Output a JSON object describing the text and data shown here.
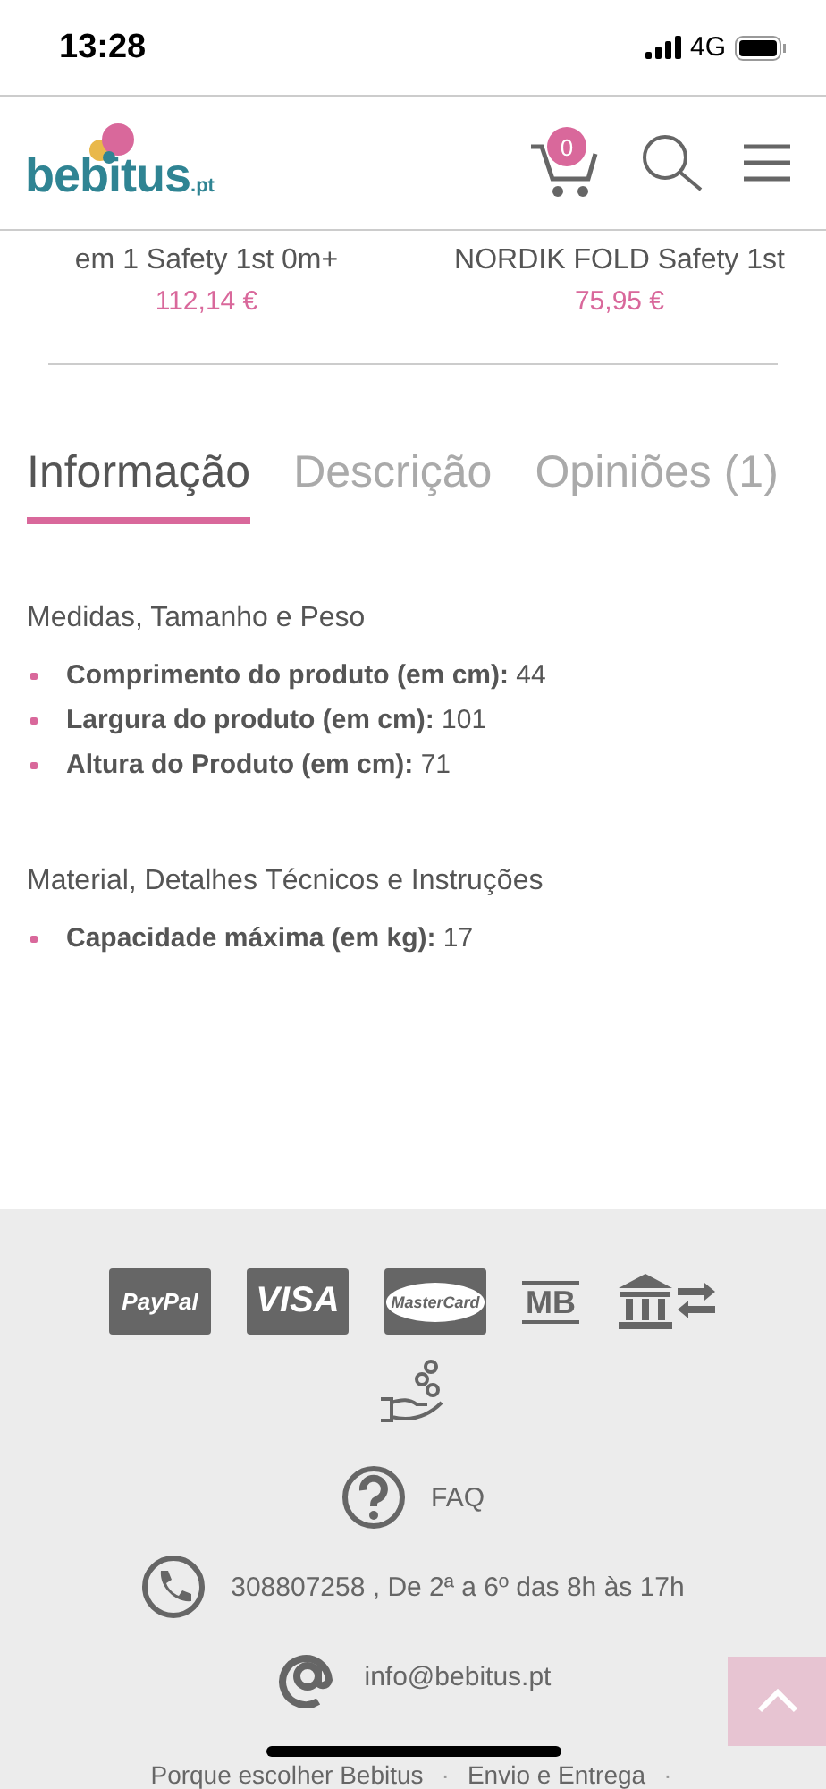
{
  "status_bar": {
    "time": "13:28",
    "network": "4G"
  },
  "header": {
    "logo": {
      "name": "bebitus",
      "suffix": ".pt"
    },
    "cart_count": "0"
  },
  "products": [
    {
      "name": "em 1 Safety 1st 0m+",
      "price": "112,14 €"
    },
    {
      "name": "NORDIK FOLD Safety 1st",
      "price": "75,95 €"
    }
  ],
  "tabs": [
    {
      "label": "Informação",
      "selected": true
    },
    {
      "label": "Descrição",
      "selected": false
    },
    {
      "label": "Opiniões (1)",
      "selected": false
    }
  ],
  "sections": [
    {
      "title": "Medidas, Tamanho e Peso",
      "items": [
        "**Comprimento do produto (em cm):** 44",
        "**Largura do produto (em cm):** 101",
        "**Altura do Produto (em cm):** 71"
      ]
    },
    {
      "title": "Material, Detalhes Técnicos e Instruções",
      "items": [
        "**Capacidade máxima (em kg):** 17"
      ]
    }
  ],
  "footer": {
    "payment_methods": [
      {
        "kind": "paypal",
        "label": "PayPal"
      },
      {
        "kind": "visa",
        "label": "VISA"
      },
      {
        "kind": "mastercard",
        "label": "MasterCard"
      },
      {
        "kind": "multibanco",
        "label": "MB"
      },
      {
        "kind": "transfer"
      },
      {
        "kind": "cash"
      }
    ],
    "contacts": [
      {
        "kind": "faq",
        "text": "FAQ"
      },
      {
        "kind": "phone",
        "text": "308807258 ,  De 2ª a 6º das 8h às 17h"
      },
      {
        "kind": "email",
        "text": "info@bebitus.pt"
      }
    ],
    "links": [
      {
        "kind": "link",
        "text": "Porque escolher Bebitus"
      },
      {
        "kind": "separator",
        "text": "·"
      },
      {
        "kind": "link",
        "text": "Envio e Entrega"
      },
      {
        "kind": "separator",
        "text": "·"
      }
    ]
  }
}
